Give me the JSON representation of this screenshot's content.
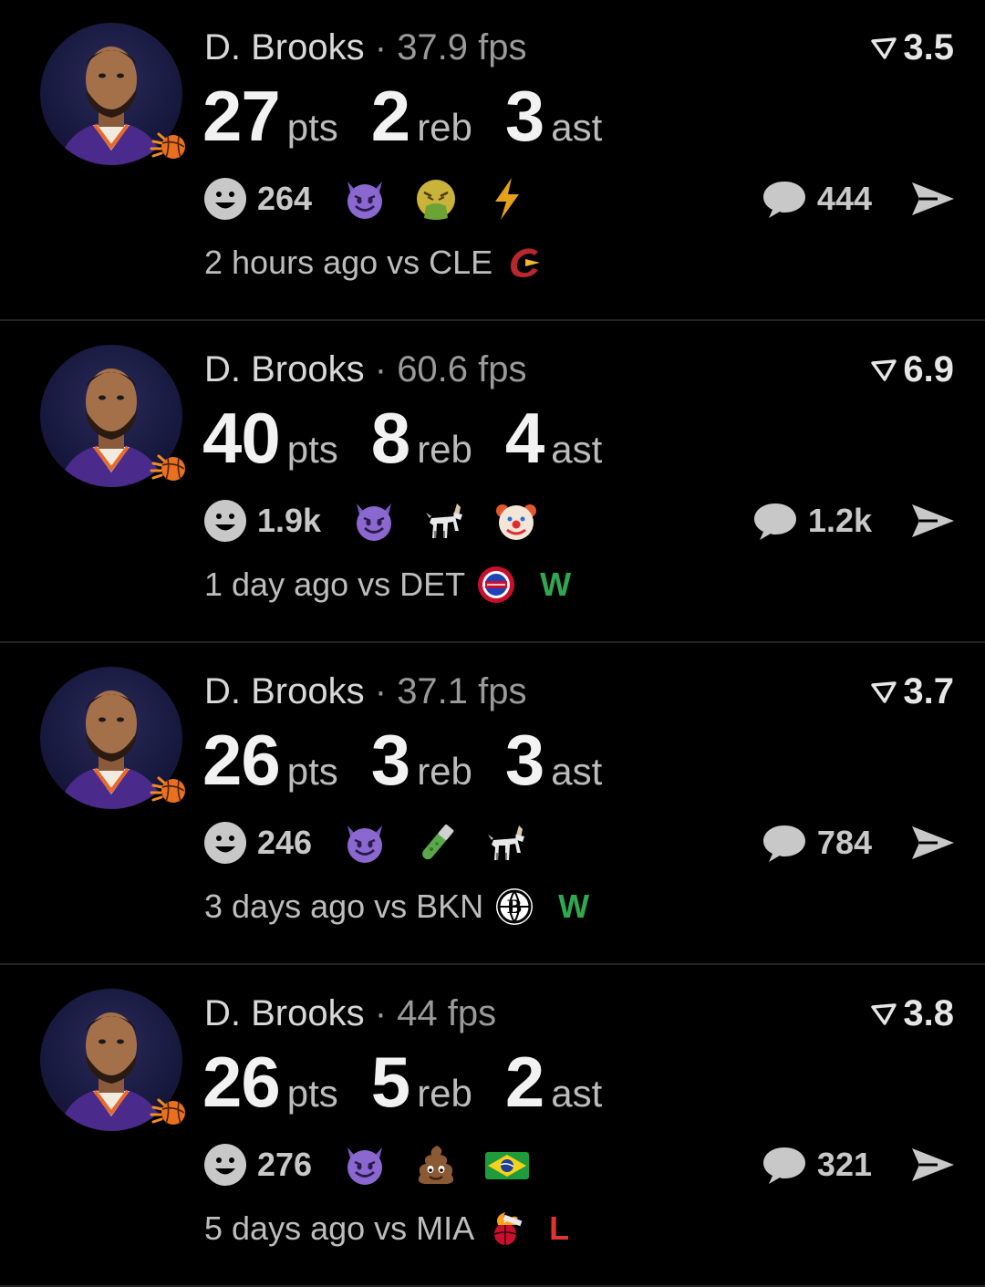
{
  "colors": {
    "background": "#000000",
    "win": "#2fa84f",
    "loss": "#e0322f",
    "divider": "#242424"
  },
  "posts": [
    {
      "player": "D. Brooks",
      "separator": "·",
      "fps": "37.9 fps",
      "rating": "3.5",
      "pts": "27",
      "pts_label": "pts",
      "reb": "2",
      "reb_label": "reb",
      "ast": "3",
      "ast_label": "ast",
      "reaction_count": "264",
      "emojis": [
        "smiling-devil",
        "nauseated-face",
        "lightning"
      ],
      "comment_count": "444",
      "time": "2 hours ago vs CLE",
      "opponent": "CLE",
      "result": ""
    },
    {
      "player": "D. Brooks",
      "separator": "·",
      "fps": "60.6 fps",
      "rating": "6.9",
      "pts": "40",
      "pts_label": "pts",
      "reb": "8",
      "reb_label": "reb",
      "ast": "4",
      "ast_label": "ast",
      "reaction_count": "1.9k",
      "emojis": [
        "smiling-devil",
        "goat",
        "clown-face"
      ],
      "comment_count": "1.2k",
      "time": "1 day ago vs DET",
      "opponent": "DET",
      "result": "W"
    },
    {
      "player": "D. Brooks",
      "separator": "·",
      "fps": "37.1 fps",
      "rating": "3.7",
      "pts": "26",
      "pts_label": "pts",
      "reb": "3",
      "reb_label": "reb",
      "ast": "3",
      "ast_label": "ast",
      "reaction_count": "246",
      "emojis": [
        "smiling-devil",
        "test-tube",
        "goat"
      ],
      "comment_count": "784",
      "time": "3 days ago vs BKN",
      "opponent": "BKN",
      "result": "W"
    },
    {
      "player": "D. Brooks",
      "separator": "·",
      "fps": "44 fps",
      "rating": "3.8",
      "pts": "26",
      "pts_label": "pts",
      "reb": "5",
      "reb_label": "reb",
      "ast": "2",
      "ast_label": "ast",
      "reaction_count": "276",
      "emojis": [
        "smiling-devil",
        "pile-of-poo",
        "brazil-flag"
      ],
      "comment_count": "321",
      "time": "5 days ago vs MIA",
      "opponent": "MIA",
      "result": "L"
    }
  ]
}
